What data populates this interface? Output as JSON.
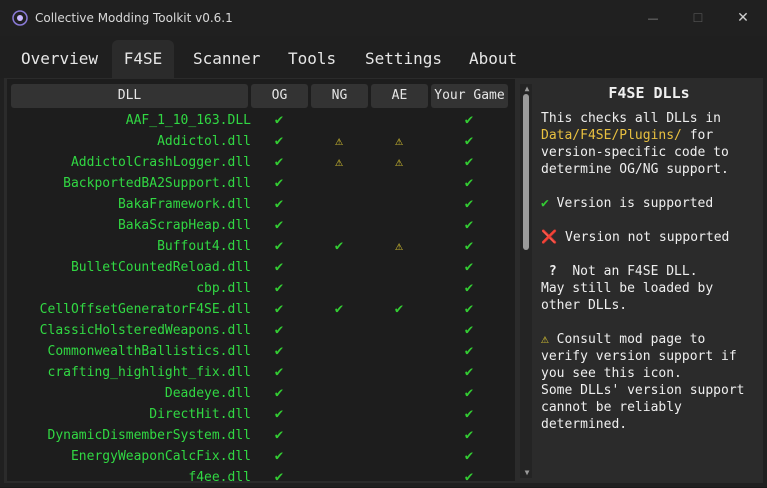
{
  "window": {
    "title": "Collective Modding Toolkit v0.6.1",
    "close_symbol": "✕",
    "max_symbol": "☐",
    "min_symbol": "—"
  },
  "tabs": [
    "Overview",
    "F4SE",
    "Scanner",
    "Tools",
    "Settings",
    "About"
  ],
  "active_tab": "F4SE",
  "table": {
    "headers": {
      "dll": "DLL",
      "og": "OG",
      "ng": "NG",
      "ae": "AE",
      "game": "Your Game"
    },
    "rows": [
      {
        "name": "AAF_1_10_163.DLL",
        "og": "check",
        "ng": "",
        "ae": "",
        "game": "check"
      },
      {
        "name": "Addictol.dll",
        "og": "check",
        "ng": "warn",
        "ae": "warn",
        "game": "check"
      },
      {
        "name": "AddictolCrashLogger.dll",
        "og": "check",
        "ng": "warn",
        "ae": "warn",
        "game": "check"
      },
      {
        "name": "BackportedBA2Support.dll",
        "og": "check",
        "ng": "",
        "ae": "",
        "game": "check"
      },
      {
        "name": "BakaFramework.dll",
        "og": "check",
        "ng": "",
        "ae": "",
        "game": "check"
      },
      {
        "name": "BakaScrapHeap.dll",
        "og": "check",
        "ng": "",
        "ae": "",
        "game": "check"
      },
      {
        "name": "Buffout4.dll",
        "og": "check",
        "ng": "check",
        "ae": "warn",
        "game": "check"
      },
      {
        "name": "BulletCountedReload.dll",
        "og": "check",
        "ng": "",
        "ae": "",
        "game": "check"
      },
      {
        "name": "cbp.dll",
        "og": "check",
        "ng": "",
        "ae": "",
        "game": "check"
      },
      {
        "name": "CellOffsetGeneratorF4SE.dll",
        "og": "check",
        "ng": "check",
        "ae": "check",
        "game": "check"
      },
      {
        "name": "ClassicHolsteredWeapons.dll",
        "og": "check",
        "ng": "",
        "ae": "",
        "game": "check"
      },
      {
        "name": "CommonwealthBallistics.dll",
        "og": "check",
        "ng": "",
        "ae": "",
        "game": "check"
      },
      {
        "name": "crafting_highlight_fix.dll",
        "og": "check",
        "ng": "",
        "ae": "",
        "game": "check"
      },
      {
        "name": "Deadeye.dll",
        "og": "check",
        "ng": "",
        "ae": "",
        "game": "check"
      },
      {
        "name": "DirectHit.dll",
        "og": "check",
        "ng": "",
        "ae": "",
        "game": "check"
      },
      {
        "name": "DynamicDismemberSystem.dll",
        "og": "check",
        "ng": "",
        "ae": "",
        "game": "check"
      },
      {
        "name": "EnergyWeaponCalcFix.dll",
        "og": "check",
        "ng": "",
        "ae": "",
        "game": "check"
      },
      {
        "name": "f4ee.dll",
        "og": "check",
        "ng": "",
        "ae": "",
        "game": "check"
      }
    ]
  },
  "symbols": {
    "check": "✔",
    "warn": "⚠",
    "cross": "❌",
    "question": "?"
  },
  "info": {
    "title": "F4SE DLLs",
    "intro_1": "This checks all DLLs in",
    "intro_path": "Data/F4SE/Plugins/",
    "intro_path_suffix": " for",
    "intro_2": "version-specific code to",
    "intro_3": "determine OG/NG support.",
    "supported": "Version is supported",
    "not_supported": "Version not supported",
    "not_f4se_1": "Not an F4SE DLL.",
    "not_f4se_2": "May still be loaded by",
    "not_f4se_3": "other DLLs.",
    "consult_1": "Consult mod page to",
    "consult_2": "verify version support if",
    "consult_3": "you see this icon.",
    "consult_4": "Some DLLs' version support",
    "consult_5": "cannot be reliably",
    "consult_6": "determined."
  }
}
